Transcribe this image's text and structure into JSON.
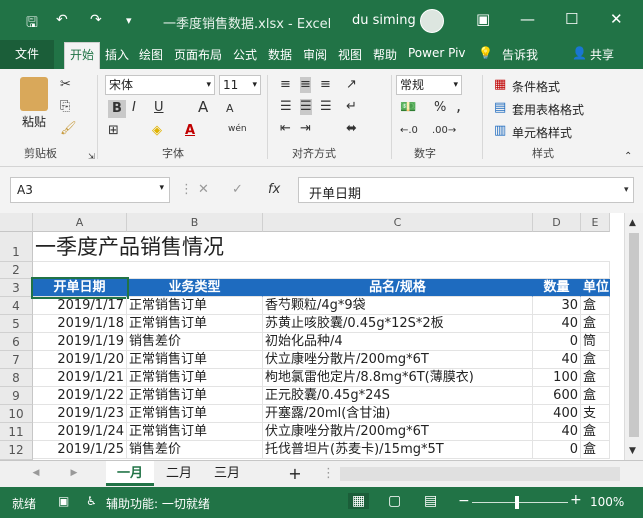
{
  "window": {
    "title": "一季度销售数据.xlsx  -  Excel",
    "user": "du siming",
    "quick": {
      "save": "🖫",
      "undo": "↶",
      "redo": "↷",
      "more": "▾"
    },
    "controls": {
      "ribbon_opts": "▣",
      "minimize": "—",
      "maximize": "☐",
      "close": "✕"
    }
  },
  "tabs": {
    "file": "文件",
    "items": [
      "开始",
      "插入",
      "绘图",
      "页面布局",
      "公式",
      "数据",
      "审阅",
      "视图",
      "帮助",
      "Power Piv"
    ],
    "tell": "告诉我",
    "share": "共享"
  },
  "ribbon": {
    "clipboard": {
      "paste": "粘贴",
      "group": "剪贴板"
    },
    "font": {
      "name": "宋体",
      "size": "11",
      "bold": "B",
      "italic": "I",
      "underline": "U",
      "grow": "A",
      "shrink": "A",
      "wen": "wén",
      "group": "字体"
    },
    "align": {
      "group": "对齐方式"
    },
    "number": {
      "format": "常规",
      "percent": "%",
      "comma": ",",
      "group": "数字"
    },
    "styles": {
      "cond": "条件格式",
      "table": "套用表格格式",
      "cell": "单元格样式",
      "group": "样式"
    }
  },
  "formula": {
    "namebox": "A3",
    "content": "开单日期",
    "cancel": "✕",
    "enter": "✓",
    "fx": "fx"
  },
  "sheet": {
    "columns": [
      "A",
      "B",
      "C",
      "D",
      "E"
    ],
    "rows": [
      "1",
      "2",
      "3",
      "4",
      "5",
      "6",
      "7",
      "8",
      "9",
      "10",
      "11",
      "12"
    ],
    "title": "一季度产品销售情况",
    "headers": [
      "开单日期",
      "业务类型",
      "品名/规格",
      "数量",
      "单位"
    ],
    "data": [
      [
        "2019/1/17",
        "正常销售订单",
        "香芍颗粒/4g*9袋",
        "30",
        "盒"
      ],
      [
        "2019/1/18",
        "正常销售订单",
        "苏黄止咳胶囊/0.45g*12S*2板",
        "40",
        "盒"
      ],
      [
        "2019/1/19",
        "销售差价",
        "初始化品种/4",
        "0",
        "筒"
      ],
      [
        "2019/1/20",
        "正常销售订单",
        "伏立康唑分散片/200mg*6T",
        "40",
        "盒"
      ],
      [
        "2019/1/21",
        "正常销售订单",
        "枸地氯雷他定片/8.8mg*6T(薄膜衣)",
        "100",
        "盒"
      ],
      [
        "2019/1/22",
        "正常销售订单",
        "正元胶囊/0.45g*24S",
        "600",
        "盒"
      ],
      [
        "2019/1/23",
        "正常销售订单",
        "开塞露/20ml(含甘油)",
        "400",
        "支"
      ],
      [
        "2019/1/24",
        "正常销售订单",
        "伏立康唑分散片/200mg*6T",
        "40",
        "盒"
      ],
      [
        "2019/1/25",
        "销售差价",
        "托伐普坦片(苏麦卡)/15mg*5T",
        "0",
        "盒"
      ]
    ]
  },
  "sheets": {
    "tabs": [
      "一月",
      "二月",
      "三月"
    ],
    "add": "+",
    "prev": "◀",
    "next": "▶"
  },
  "status": {
    "ready": "就绪",
    "accessibility": "辅助功能: 一切就绪",
    "zoom": "100%",
    "minus": "−",
    "plus": "+"
  }
}
